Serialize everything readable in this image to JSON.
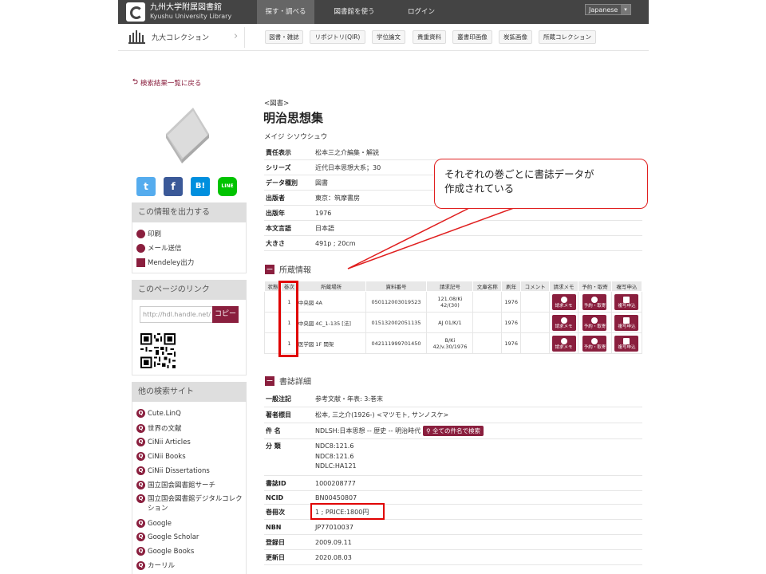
{
  "header": {
    "logo_line1": "九州大学附属図書館",
    "logo_line2": "Kyushu University Library",
    "nav": [
      "探す・調べる",
      "図書館を使う",
      "ログイン"
    ],
    "language": "Japanese"
  },
  "subnav": {
    "collection": "九大コレクション",
    "tabs": [
      "図書・雑誌",
      "リポジトリ(QIR)",
      "学位論文",
      "貴重資料",
      "叢書印画像",
      "炭鉱画像",
      "所蔵コレクション"
    ]
  },
  "back_link": "検索結果一覧に戻る",
  "sidebar": {
    "output_heading": "この情報を出力する",
    "output_links": [
      "印刷",
      "メール送信",
      "Mendeley出力"
    ],
    "link_heading": "このページのリンク",
    "link_value": "http://hdl.handle.net/",
    "copy_label": "コピー",
    "other_heading": "他の検索サイト",
    "other_sites": [
      "Cute.LinQ",
      "世界の文献",
      "CiNii Articles",
      "CiNii Books",
      "CiNii Dissertations",
      "国立国会図書館サーチ",
      "国立国会図書館デジタルコレクション",
      "Google",
      "Google Scholar",
      "Google Books",
      "カーリル"
    ]
  },
  "record": {
    "material_type": "<図書>",
    "title": "明治思想集",
    "title_yomi": "メイジ シソウシュウ",
    "fields": [
      {
        "key": "責任表示",
        "value": "松本三之介編集・解説"
      },
      {
        "key": "シリーズ",
        "value": "近代日本思想大系",
        "suffix": "；30"
      },
      {
        "key": "データ種別",
        "value": "図書"
      },
      {
        "key": "出版者",
        "value": "東京：筑摩書房"
      },
      {
        "key": "出版年",
        "value": "1976"
      },
      {
        "key": "本文言語",
        "value": "日本語"
      },
      {
        "key": "大きさ",
        "value": "491p ; 20cm"
      }
    ]
  },
  "holdings": {
    "heading": "所蔵情報",
    "columns": [
      "状態",
      "巻次",
      "所蔵場所",
      "資料番号",
      "請求記号",
      "文庫名称",
      "刷年",
      "コメント",
      "請求メモ",
      "予約・取寄",
      "複写申込"
    ],
    "rows": [
      {
        "vol": "1",
        "location": "中央図 4A",
        "id": "050112003019523",
        "call": "121.08/Ki 42/(30)",
        "year": "1976"
      },
      {
        "vol": "1",
        "location": "中央図 4C_1-135 [法]",
        "id": "015132002051135",
        "call": "AJ 01/K/1",
        "year": "1976"
      },
      {
        "vol": "1",
        "location": "医学図 1F 開架",
        "id": "042111999701450",
        "call": "B/Ki 42/v.30/1976",
        "year": "1976"
      }
    ],
    "btn_memo": "請求メモ",
    "btn_reserve": "予約・取寄",
    "btn_copy": "複写申込"
  },
  "details": {
    "heading": "書誌詳細",
    "note_key": "一般注記",
    "note_value": "参考文献・年表: 3:巻末",
    "author_key": "著者標目",
    "author_link": "松本, 三之介(1926-)",
    "author_yomi": " <マツモト, サンノスケ>",
    "subject_key": "件 名",
    "subject_prefix": "NDLSH:",
    "subject_links": [
      "日本思想",
      "歴史",
      "明治時代"
    ],
    "subject_button": "全ての件名で検索",
    "class_key": "分 類",
    "class_lines": [
      {
        "prefix": "NDC8:",
        "link": "121.6"
      },
      {
        "prefix": "NDC8:",
        "link": "121.6"
      },
      {
        "prefix": "NDLC:",
        "link": "HA121"
      }
    ],
    "bibid_key": "書誌ID",
    "bibid_value": "1000208777",
    "ncid_key": "NCID",
    "ncid_value": "BN00450807",
    "volume_key": "巻冊次",
    "volume_value": "1 ; PRICE:1800円",
    "nbn_key": "NBN",
    "nbn_value": "JP77010037",
    "registered_key": "登録日",
    "registered_value": "2009.09.11",
    "updated_key": "更新日",
    "updated_value": "2020.08.03"
  },
  "callout": {
    "line1": "それぞれの巻ごとに書誌データが",
    "line2": "作成されている"
  },
  "colors": {
    "accent": "#8a1f3e",
    "annotation": "#e00000",
    "header_bg": "#444444"
  }
}
